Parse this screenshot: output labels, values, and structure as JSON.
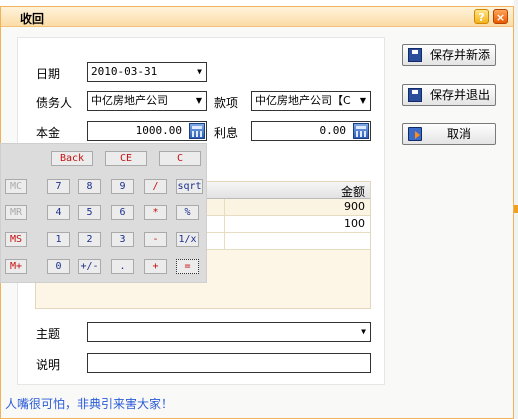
{
  "window": {
    "title": "收回",
    "help_icon": "question-icon",
    "close_icon": "close-icon"
  },
  "form": {
    "date_label": "日期",
    "date_value": "2010-03-31",
    "debtor_label": "债务人",
    "debtor_value": "中亿房地产公司",
    "account_label": "款项",
    "account_value": "中亿房地产公司【C",
    "principal_label": "本金",
    "principal_value": "1000.00",
    "interest_label": "利息",
    "interest_value": "0.00",
    "subject_label": "主题",
    "subject_value": "",
    "note_label": "说明",
    "note_value": ""
  },
  "grid": {
    "amount_header": "金额",
    "rows": [
      "900",
      "100"
    ]
  },
  "calculator": {
    "top": [
      "Back",
      "CE",
      "C"
    ],
    "memory": [
      "MC",
      "MR",
      "MS",
      "M+"
    ],
    "keys": [
      [
        "7",
        "8",
        "9",
        "/",
        "sqrt"
      ],
      [
        "4",
        "5",
        "6",
        "*",
        "%"
      ],
      [
        "1",
        "2",
        "3",
        "-",
        "1/x"
      ],
      [
        "0",
        "+/-",
        ".",
        "+",
        "="
      ]
    ]
  },
  "buttons": {
    "save_new": "保存并新添",
    "save_exit": "保存并退出",
    "cancel": "取消"
  },
  "footer": {
    "slogan": "人嘴很可怕，非典引来害大家！"
  },
  "colors": {
    "title_bar": "#fbdca5",
    "border": "#f0b35a",
    "link": "#2a5bd7"
  }
}
